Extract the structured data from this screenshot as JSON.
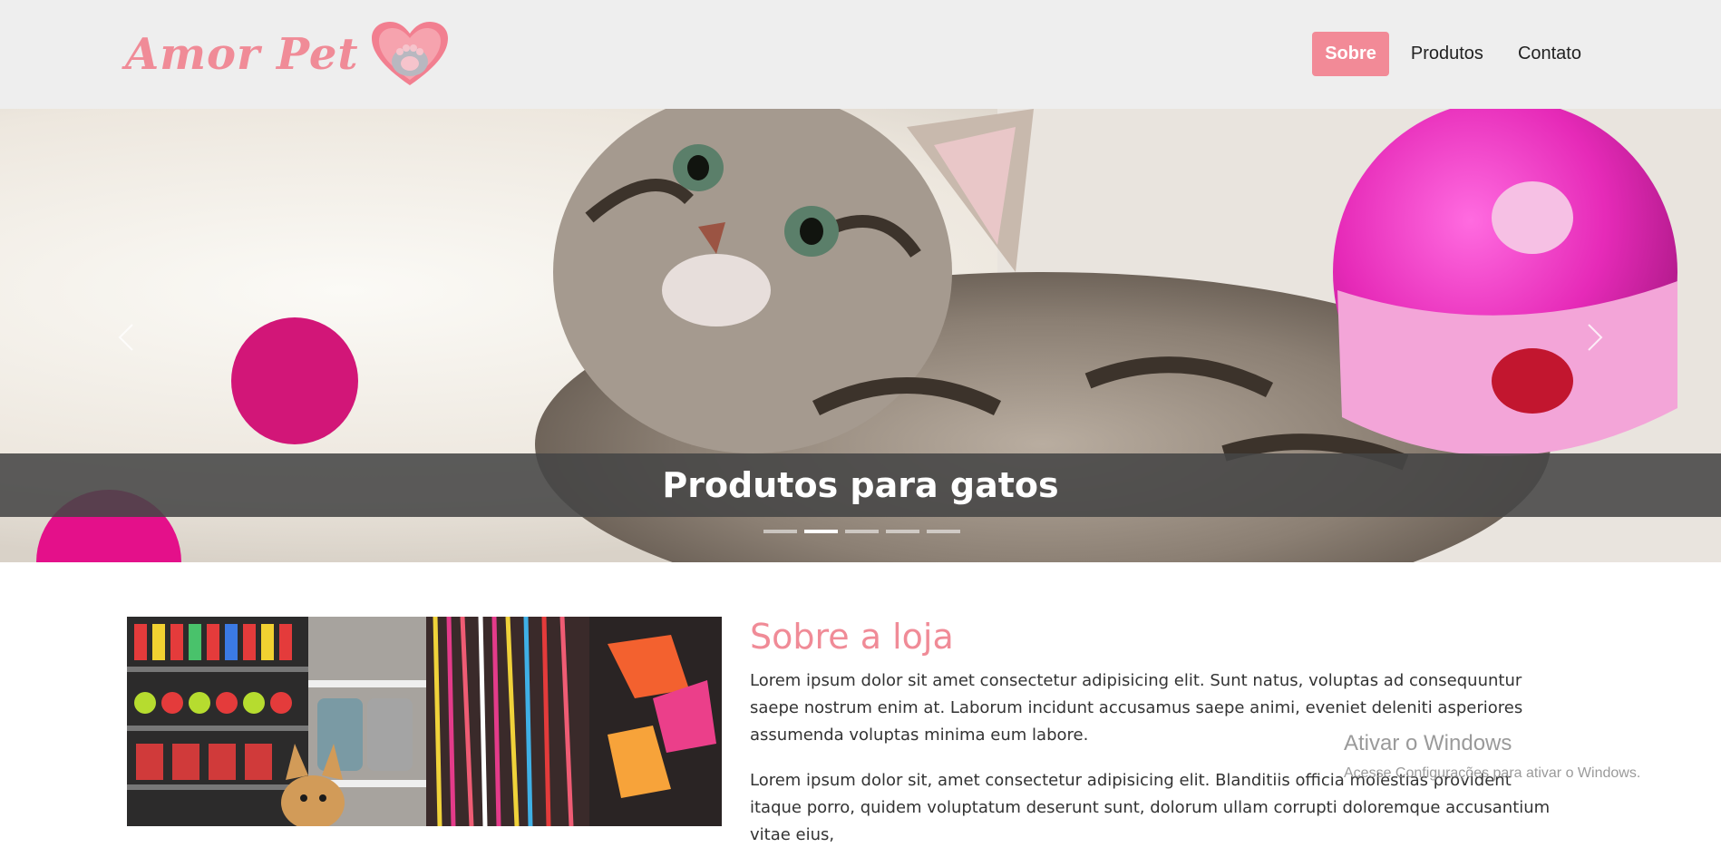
{
  "header": {
    "brand": "Amor Pet",
    "nav": [
      {
        "label": "Sobre",
        "active": true
      },
      {
        "label": "Produtos",
        "active": false
      },
      {
        "label": "Contato",
        "active": false
      }
    ]
  },
  "hero": {
    "caption": "Produtos para gatos",
    "prev_icon": "chevron-left-icon",
    "next_icon": "chevron-right-icon",
    "slide_count": 5,
    "active_slide": 2
  },
  "about": {
    "title": "Sobre a loja",
    "paragraphs": [
      "Lorem ipsum dolor sit amet consectetur adipisicing elit. Sunt natus, voluptas ad consequuntur saepe nostrum enim at. Laborum incidunt accusamus saepe animi, eveniet deleniti asperiores assumenda voluptas minima eum labore.",
      "Lorem ipsum dolor sit, amet consectetur adipisicing elit. Blanditiis officia molestias provident itaque porro, quidem voluptatum deserunt sunt, dolorum ullam corrupti doloremque accusantium vitae eius,"
    ]
  },
  "watermark": {
    "title": "Ativar o Windows",
    "subtitle": "Acesse Configurações para ativar o Windows."
  },
  "colors": {
    "brand_pink": "#f08b97",
    "header_bg": "#eeeeee",
    "caption_bg": "#464646"
  }
}
